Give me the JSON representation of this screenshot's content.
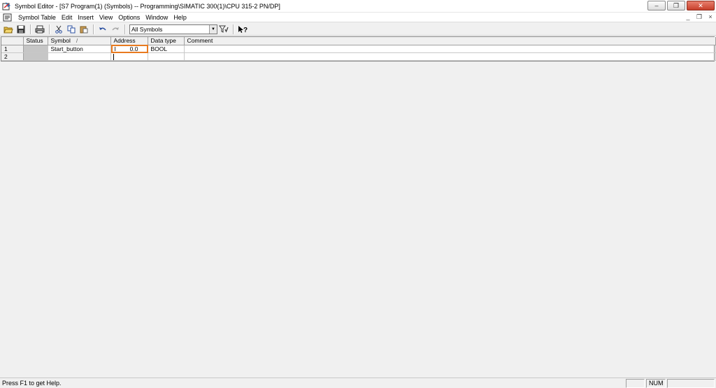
{
  "window": {
    "title": "Symbol Editor - [S7 Program(1) (Symbols) -- Programming\\SIMATIC 300(1)\\CPU 315-2 PN/DP]",
    "minimize": "–",
    "restore": "❐",
    "close": "✕"
  },
  "menu": {
    "items": [
      "Symbol Table",
      "Edit",
      "Insert",
      "View",
      "Options",
      "Window",
      "Help"
    ],
    "mdi_minimize": "_",
    "mdi_restore": "❐",
    "mdi_close": "×"
  },
  "toolbar": {
    "filter_value": "All Symbols"
  },
  "table": {
    "headers": {
      "status": "Status",
      "symbol": "Symbol",
      "symbol_sort": "/",
      "address": "Address",
      "data_type": "Data type",
      "comment": "Comment"
    },
    "rows": [
      {
        "num": "1",
        "status": "",
        "symbol": "Start_button",
        "address_op": "I",
        "address_num": "0.0",
        "data_type": "BOOL",
        "comment": ""
      },
      {
        "num": "2",
        "status": "",
        "symbol": "",
        "address_op": "",
        "address_num": "",
        "data_type": "",
        "comment": ""
      }
    ]
  },
  "statusbar": {
    "help_text": "Press F1 to get Help.",
    "num": "NUM"
  },
  "colors": {
    "focus_border": "#e87a1f",
    "close_button": "#c7402b"
  }
}
